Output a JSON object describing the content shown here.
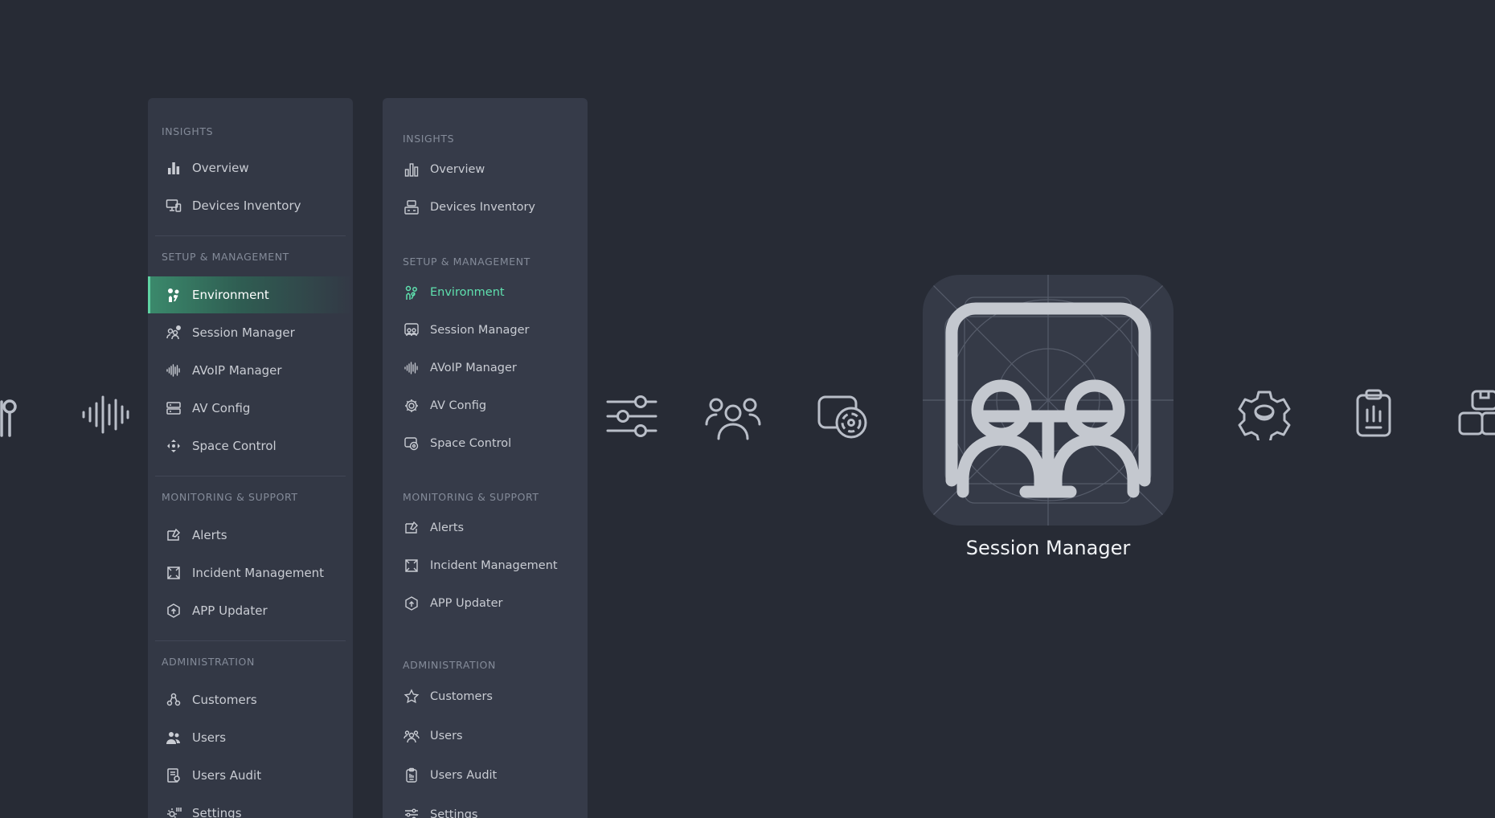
{
  "panel_a": {
    "sections": [
      {
        "title": "INSIGHTS",
        "items": [
          "Overview",
          "Devices Inventory"
        ]
      },
      {
        "title": "SETUP & MANAGEMENT",
        "items": [
          "Environment",
          "Session Manager",
          "AVoIP Manager",
          "AV Config",
          "Space Control"
        ]
      },
      {
        "title": "MONITORING & SUPPORT",
        "items": [
          "Alerts",
          "Incident Management",
          "APP Updater"
        ]
      },
      {
        "title": "ADMINISTRATION",
        "items": [
          "Customers",
          "Users",
          "Users Audit",
          "Settings"
        ]
      }
    ],
    "active_item": "Environment"
  },
  "panel_b": {
    "sections": [
      {
        "title": "INSIGHTS",
        "items": [
          "Overview",
          "Devices Inventory"
        ]
      },
      {
        "title": "SETUP & MANAGEMENT",
        "items": [
          "Environment",
          "Session Manager",
          "AVoIP Manager",
          "AV Config",
          "Space Control"
        ]
      },
      {
        "title": "MONITORING & SUPPORT",
        "items": [
          "Alerts",
          "Incident Management",
          "APP Updater"
        ]
      },
      {
        "title": "ADMINISTRATION",
        "items": [
          "Customers",
          "Users",
          "Users Audit",
          "Settings"
        ]
      }
    ],
    "active_item": "Environment"
  },
  "featured": {
    "label": "Session Manager",
    "icon": "session-manager-icon"
  },
  "icon_strip": [
    "environment-icon",
    "waveform-icon",
    "sliders-icon",
    "users-group-icon",
    "screen-target-icon",
    "gear-icon",
    "clipboard-icon",
    "boxes-icon"
  ],
  "colors": {
    "background": "#272b35",
    "panel": "#333845",
    "accent": "#5fd3a3",
    "active_text_b": "#5fe0ae",
    "text": "#c9ccd3",
    "section_title": "#848b99"
  }
}
